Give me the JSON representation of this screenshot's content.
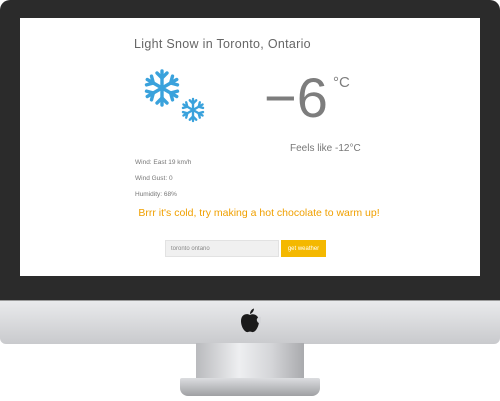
{
  "weather": {
    "title": "Light Snow in Toronto, Ontario",
    "temperature": "−6",
    "unit": "°C",
    "feels_like": "Feels like -12°C",
    "wind": "Wind: East 19 km/h",
    "wind_gust": "Wind Gust: 0",
    "humidity": "Humidity: 68%",
    "message": "Brrr it's cold, try making a hot chocolate to warm up!",
    "icon": "snowflake-icon"
  },
  "search": {
    "value": "toronto ontario",
    "button_label": "get weather"
  },
  "colors": {
    "snowflake": "#3aa2dc",
    "message": "#f0a000",
    "button": "#f4b800",
    "bezel": "#2b2b2b"
  }
}
